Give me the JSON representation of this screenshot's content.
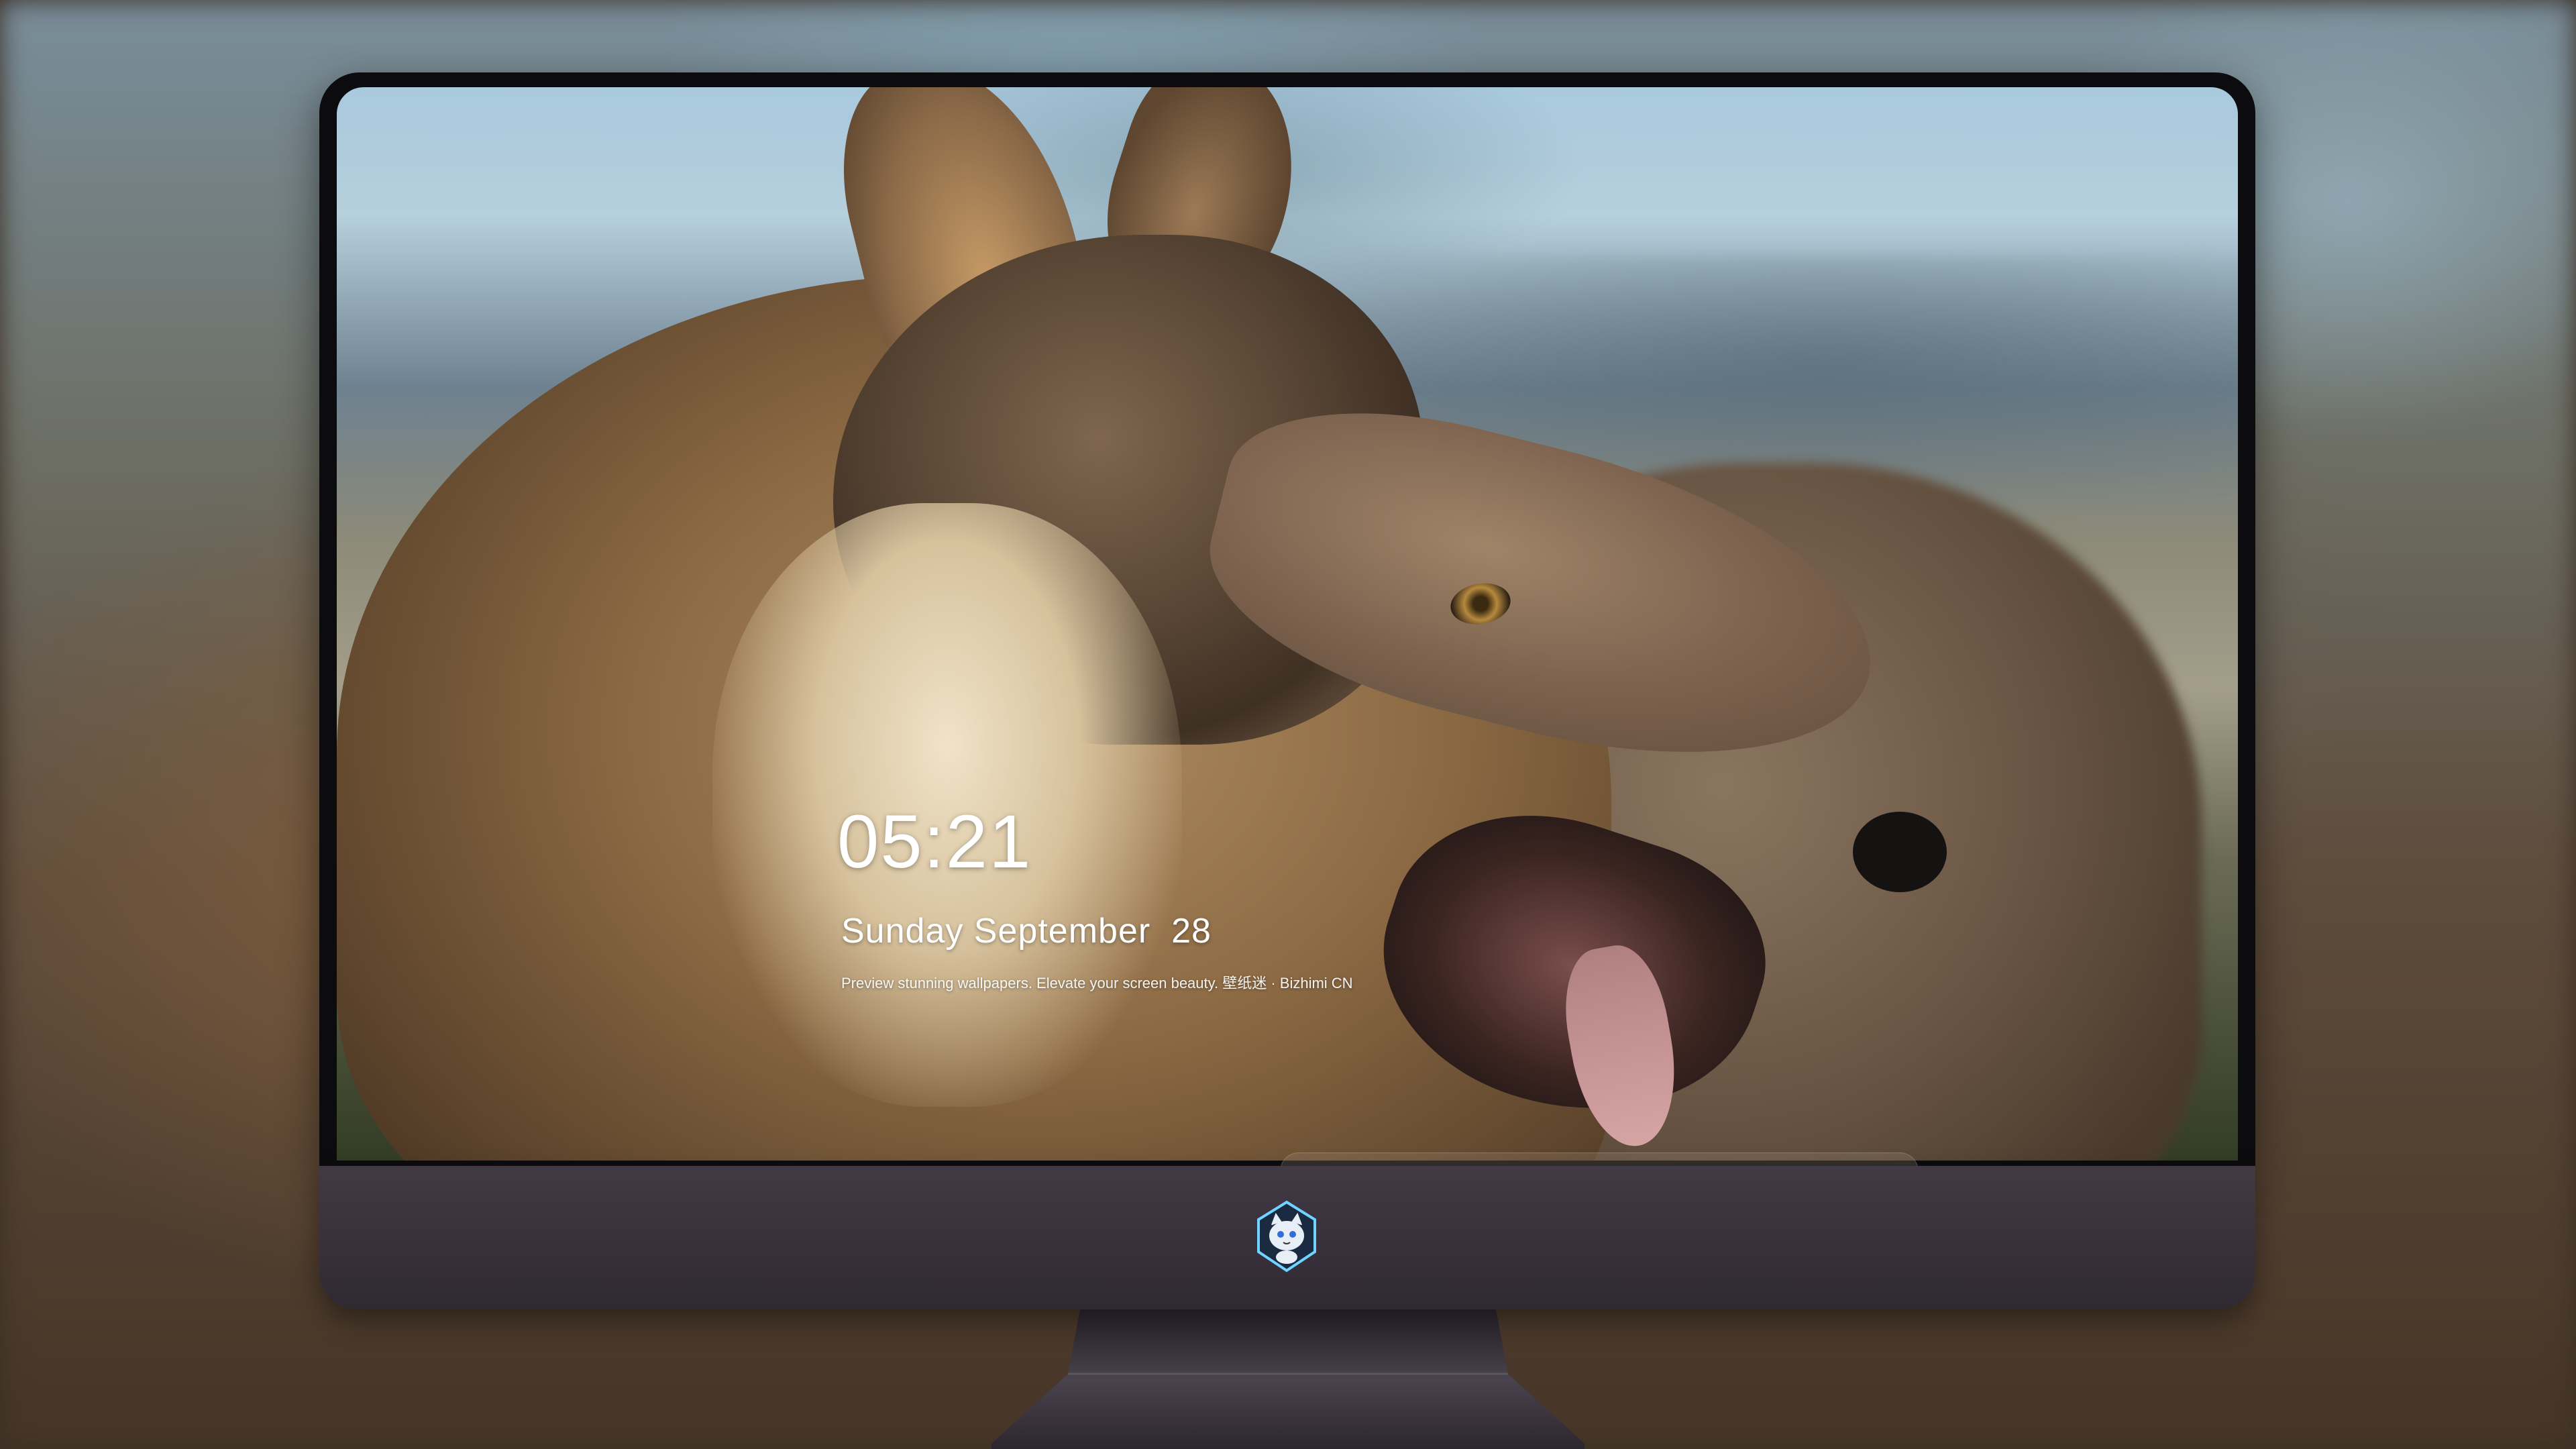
{
  "lock_screen": {
    "time": "05:21",
    "date": "Sunday September  28",
    "caption": "Preview stunning wallpapers. Elevate your screen beauty. 壁纸迷 · Bizhimi CN"
  },
  "dock": {
    "apps": [
      {
        "icon": "messages-icon"
      },
      {
        "icon": "weather-icon"
      },
      {
        "icon": "clock-icon"
      },
      {
        "icon": "maps-icon"
      },
      {
        "icon": "clips-icon"
      },
      {
        "icon": "notes-icon"
      },
      {
        "icon": "photos-icon"
      },
      {
        "icon": "music-icon"
      },
      {
        "icon": "app-store-icon"
      },
      {
        "icon": "camera-icon"
      }
    ]
  },
  "monitor": {
    "logo_icon": "bizhimi-cat-logo-icon",
    "chin_color": "#3b343e",
    "bezel_color": "#0c0c0e"
  }
}
